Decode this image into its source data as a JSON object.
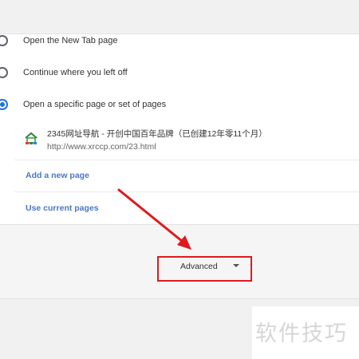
{
  "startup": {
    "options": [
      {
        "label": "Open the New Tab page",
        "checked": false
      },
      {
        "label": "Continue where you left off",
        "checked": false
      },
      {
        "label": "Open a specific page or set of pages",
        "checked": true
      }
    ],
    "pages": [
      {
        "title": "2345网址导航 - 开创中国百年品牌（已创建12年零11个月）",
        "url": "http://www.xrccp.com/23.html",
        "icon": "site-favicon-icon"
      }
    ],
    "add_page_label": "Add a new page",
    "use_current_label": "Use current pages"
  },
  "advanced": {
    "label": "Advanced",
    "icon": "dropdown-caret-icon"
  },
  "annotation": {
    "highlight_color": "#e0191d"
  },
  "watermark": {
    "text": "软件技巧"
  },
  "colors": {
    "accent": "#1a73e8",
    "link": "#4b76c9"
  }
}
